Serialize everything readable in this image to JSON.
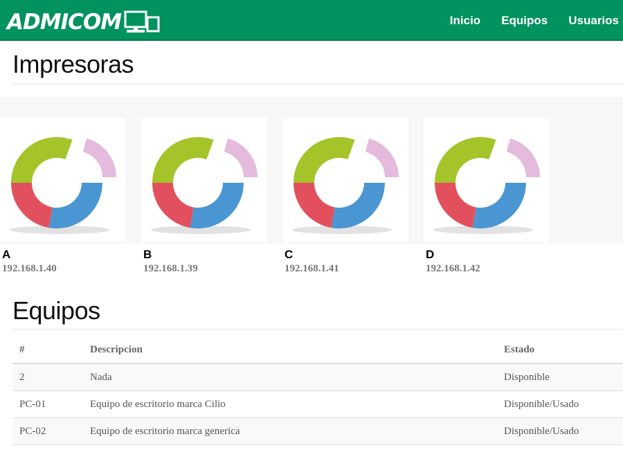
{
  "brand": {
    "name": "ADMICOM"
  },
  "nav": {
    "links": [
      "Inicio",
      "Equipos",
      "Usuarios"
    ]
  },
  "impresoras": {
    "title": "Impresoras",
    "items": [
      {
        "name": "A",
        "ip": "192.168.1.40"
      },
      {
        "name": "B",
        "ip": "192.168.1.39"
      },
      {
        "name": "C",
        "ip": "192.168.1.41"
      },
      {
        "name": "D",
        "ip": "192.168.1.42"
      }
    ],
    "donut_colors": {
      "green": "#a4c42a",
      "pink": "#e4bbdc",
      "blue": "#4a96d2",
      "red": "#e2505d"
    }
  },
  "equipos": {
    "title": "Equipos",
    "headers": [
      "#",
      "Descripcion",
      "Estado"
    ],
    "rows": [
      [
        "2",
        "Nada",
        "Disponible"
      ],
      [
        "PC-01",
        "Equipo de escritorio marca Cilio",
        "Disponible/Usado"
      ],
      [
        "PC-02",
        "Equipo de escritorio marca generica",
        "Disponible/Usado"
      ]
    ]
  },
  "colors": {
    "navbar": "#00925f",
    "nav_text": "#ffffff"
  }
}
